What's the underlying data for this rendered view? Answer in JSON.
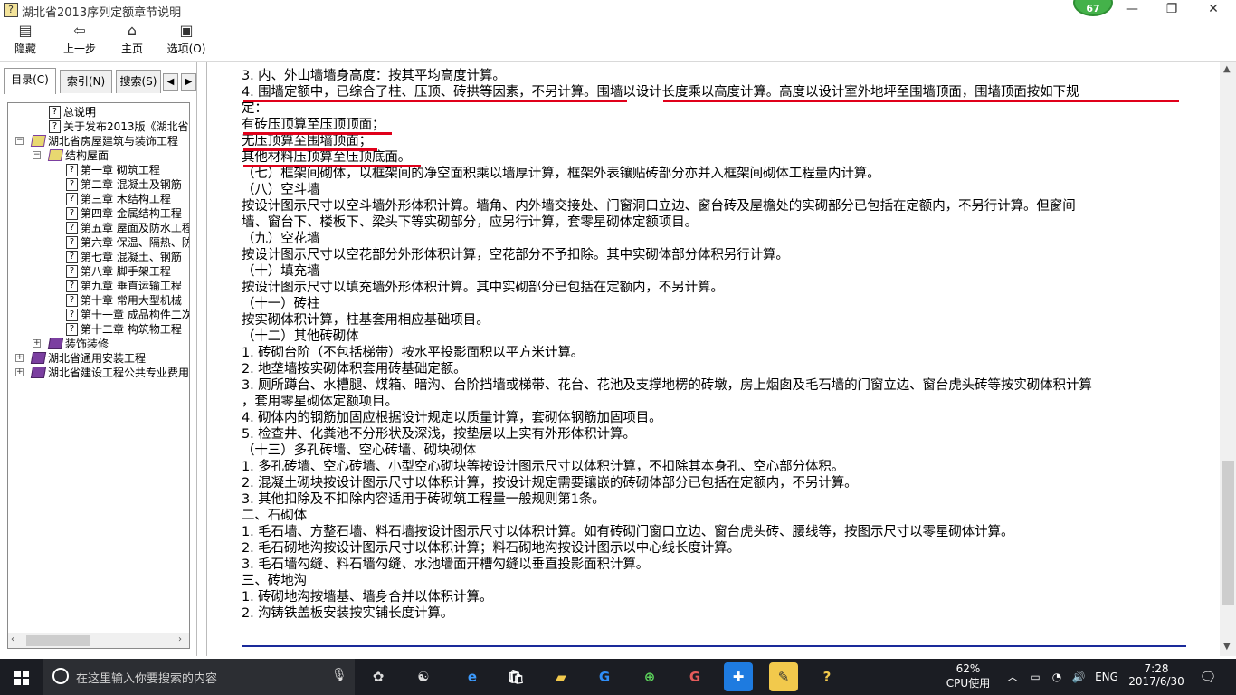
{
  "window": {
    "title": "湖北省2013序列定额章节说明",
    "badge": "67"
  },
  "toolbar": [
    {
      "label": "隐藏",
      "icon": "hide-icon"
    },
    {
      "label": "上一步",
      "icon": "back-arrow-icon"
    },
    {
      "label": "主页",
      "icon": "home-icon"
    },
    {
      "label": "选项(O)",
      "icon": "options-icon"
    }
  ],
  "tabs": [
    {
      "label": "目录(C)"
    },
    {
      "label": "索引(N)"
    },
    {
      "label": "搜索(S)"
    }
  ],
  "tree": [
    {
      "label": "总说明",
      "type": "doc",
      "depth": 1
    },
    {
      "label": "关于发布2013版《湖北省房屋",
      "type": "doc",
      "depth": 1
    },
    {
      "label": "湖北省房屋建筑与装饰工程",
      "type": "book-open",
      "depth": 0,
      "exp": "⊟"
    },
    {
      "label": "结构屋面",
      "type": "book-open",
      "depth": 1,
      "exp": "⊟"
    },
    {
      "label": "第一章  砌筑工程",
      "type": "doc",
      "depth": 2
    },
    {
      "label": "第二章  混凝土及钢筋",
      "type": "doc",
      "depth": 2
    },
    {
      "label": "第三章  木结构工程",
      "type": "doc",
      "depth": 2
    },
    {
      "label": "第四章  金属结构工程",
      "type": "doc",
      "depth": 2
    },
    {
      "label": "第五章  屋面及防水工程",
      "type": "doc",
      "depth": 2
    },
    {
      "label": "第六章  保温、隔热、防",
      "type": "doc",
      "depth": 2
    },
    {
      "label": "第七章  混凝土、钢筋",
      "type": "doc",
      "depth": 2
    },
    {
      "label": "第八章  脚手架工程",
      "type": "doc",
      "depth": 2
    },
    {
      "label": "第九章  垂直运输工程",
      "type": "doc",
      "depth": 2
    },
    {
      "label": "第十章  常用大型机械",
      "type": "doc",
      "depth": 2
    },
    {
      "label": "第十一章  成品构件二次",
      "type": "doc",
      "depth": 2
    },
    {
      "label": "第十二章  构筑物工程",
      "type": "doc",
      "depth": 2
    },
    {
      "label": "装饰装修",
      "type": "book",
      "depth": 1,
      "exp": "⊞"
    },
    {
      "label": "湖北省通用安装工程",
      "type": "book",
      "depth": 0,
      "exp": "⊞"
    },
    {
      "label": "湖北省建设工程公共专业费用",
      "type": "book",
      "depth": 0,
      "exp": "⊞"
    }
  ],
  "content": {
    "lines": [
      "3. 内、外山墙墙身高度：按其平均高度计算。",
      "4. 围墙定额中，已综合了柱、压顶、砖拱等因素，不另计算。围墙以设计长度乘以高度计算。高度以设计室外地坪至围墙顶面，围墙顶面按如下规",
      "定：",
      "有砖压顶算至压顶顶面；",
      "无压顶算至围墙顶面；",
      "其他材料压顶算至压顶底面。",
      "（七）框架间砌体，以框架间的净空面积乘以墙厚计算，框架外表镶贴砖部分亦并入框架间砌体工程量内计算。",
      "（八）空斗墙",
      "按设计图示尺寸以空斗墙外形体积计算。墙角、内外墙交接处、门窗洞口立边、窗台砖及屋檐处的实砌部分已包括在定额内，不另行计算。但窗间",
      "墙、窗台下、楼板下、梁头下等实砌部分，应另行计算，套零星砌体定额项目。",
      "（九）空花墙",
      "按设计图示尺寸以空花部分外形体积计算，空花部分不予扣除。其中实砌体部分体积另行计算。",
      "（十）填充墙",
      "按设计图示尺寸以填充墙外形体积计算。其中实砌部分已包括在定额内，不另计算。",
      "（十一）砖柱",
      "按实砌体积计算，柱基套用相应基础项目。",
      "（十二）其他砖砌体",
      "1. 砖砌台阶（不包括梯带）按水平投影面积以平方米计算。",
      "2. 地垄墙按实砌体积套用砖基础定额。",
      "3. 厕所蹲台、水槽腿、煤箱、暗沟、台阶挡墙或梯带、花台、花池及支撑地楞的砖墩，房上烟囱及毛石墙的门窗立边、窗台虎头砖等按实砌体积计算",
      "，套用零星砌体定额项目。",
      "4. 砌体内的钢筋加固应根据设计规定以质量计算，套砌体钢筋加固项目。",
      "5. 检查井、化粪池不分形状及深浅，按垫层以上实有外形体积计算。",
      "（十三）多孔砖墙、空心砖墙、砌块砌体",
      "1. 多孔砖墙、空心砖墙、小型空心砌块等按设计图示尺寸以体积计算，不扣除其本身孔、空心部分体积。",
      "2. 混凝土砌块按设计图示尺寸以体积计算，按设计规定需要镶嵌的砖砌体部分已包括在定额内，不另计算。",
      "3. 其他扣除及不扣除内容适用于砖砌筑工程量一般规则第1条。",
      "二、石砌体",
      "1. 毛石墙、方整石墙、料石墙按设计图示尺寸以体积计算。如有砖砌门窗口立边、窗台虎头砖、腰线等，按图示尺寸以零星砌体计算。",
      "2. 毛石砌地沟按设计图示尺寸以体积计算；料石砌地沟按设计图示以中心线长度计算。",
      "3. 毛石墙勾缝、料石墙勾缝、水池墙面开槽勾缝以垂直投影面积计算。",
      "三、砖地沟",
      "1. 砖砌地沟按墙基、墙身合并以体积计算。",
      "2. 沟铸铁盖板安装按实铺长度计算。"
    ]
  },
  "taskbar": {
    "search_placeholder": "在这里输入你要搜索的内容",
    "cpu_percent": "62%",
    "cpu_label": "CPU使用",
    "lang": "ENG",
    "time": "7:28",
    "date": "2017/6/30"
  },
  "colors": {
    "annotation_red": "#e0001a",
    "rule_blue": "#1a2a9a",
    "taskbar": "#1b1d23"
  }
}
